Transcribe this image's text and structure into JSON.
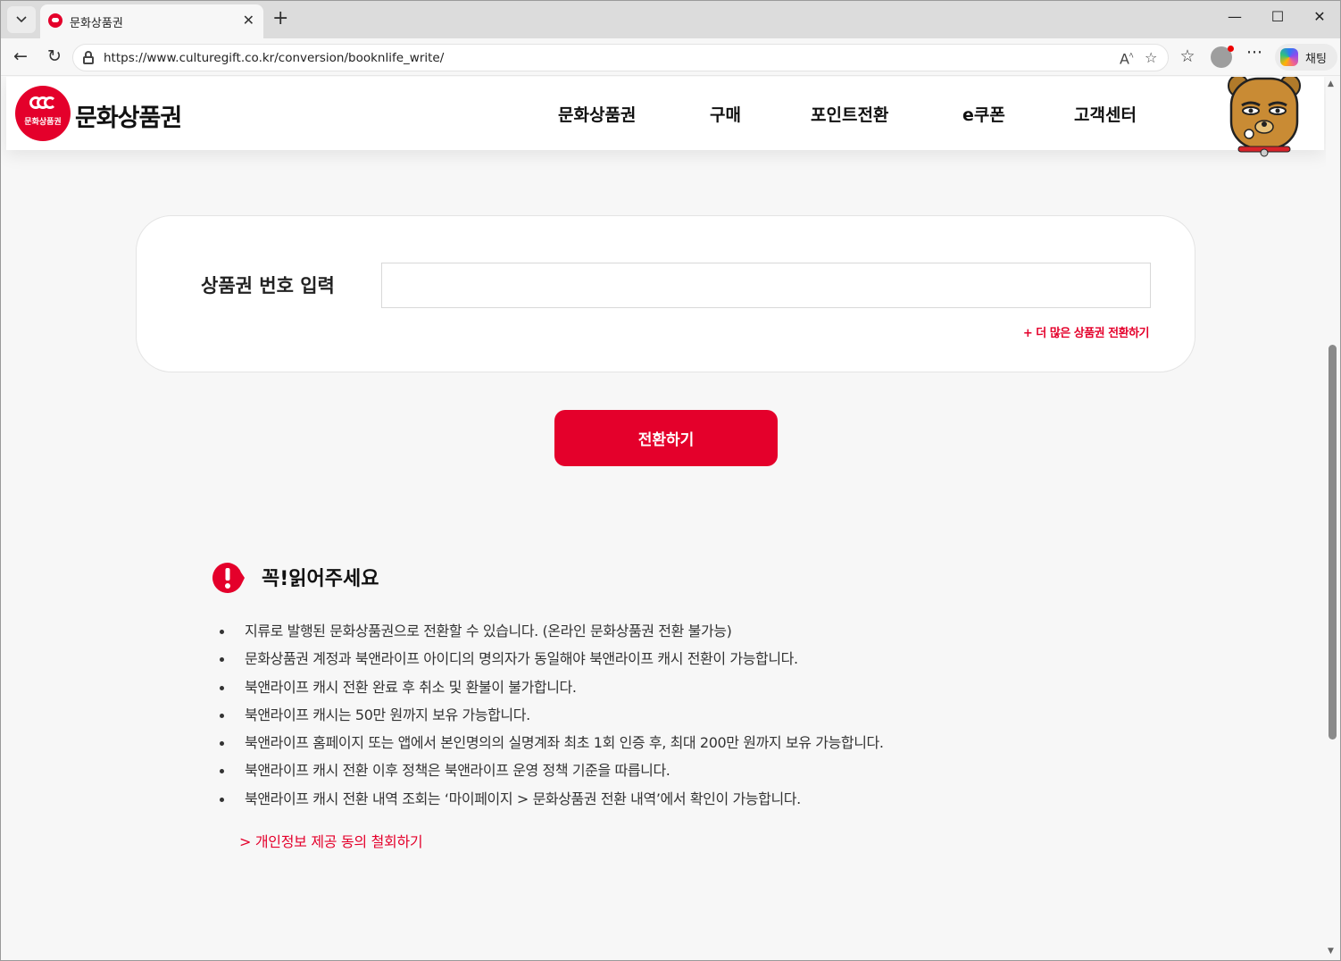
{
  "browser": {
    "tab_title": "문화상품권",
    "url": "https://www.culturegift.co.kr/conversion/booknlife_write/",
    "copilot_label": "채팅"
  },
  "site": {
    "logo_small_text": "문화상품권",
    "logo_text": "문화상품권",
    "nav": [
      "문화상품권",
      "구매",
      "포인트전환",
      "e쿠폰",
      "고객센터"
    ]
  },
  "form": {
    "label": "상품권 번호 입력",
    "input_value": "",
    "more_link": "+ 더 많은 상품권 전환하기",
    "submit_label": "전환하기"
  },
  "notice": {
    "title": "꼭!읽어주세요",
    "items": [
      "지류로 발행된 문화상품권으로 전환할 수 있습니다. (온라인 문화상품권 전환 불가능)",
      "문화상품권 계정과 북앤라이프 아이디의 명의자가 동일해야 북앤라이프 캐시 전환이 가능합니다.",
      "북앤라이프 캐시 전환 완료 후 취소 및 환불이 불가합니다.",
      "북앤라이프 캐시는 50만 원까지 보유 가능합니다.",
      "북앤라이프 홈페이지 또는 앱에서 본인명의의 실명계좌 최초 1회 인증 후, 최대 200만 원까지 보유 가능합니다.",
      "북앤라이프 캐시 전환 이후 정책은 북앤라이프 운영 정책 기준을 따릅니다.",
      "북앤라이프 캐시 전환 내역 조회는 ‘마이페이지 > 문화상품권 전환 내역’에서 확인이 가능합니다."
    ],
    "withdraw_link": "> 개인정보 제공 동의 철회하기"
  },
  "colors": {
    "brand_red": "#e4002b",
    "background": "#f7f7f7"
  }
}
